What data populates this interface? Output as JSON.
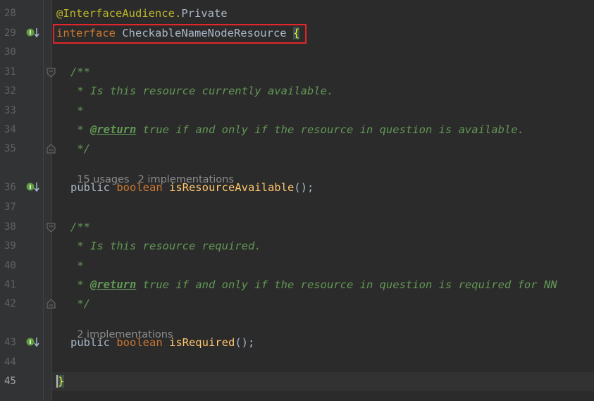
{
  "editor": {
    "lines": [
      {
        "num": "28",
        "text_ann": "@InterfaceAudience.",
        "text_ann2": "Private"
      },
      {
        "num": "29",
        "kw": "interface ",
        "name": "CheckableNameNodeResource ",
        "brace": "{"
      },
      {
        "num": "30"
      },
      {
        "num": "31",
        "doc": "/**"
      },
      {
        "num": "32",
        "doc": " * Is this resource currently available."
      },
      {
        "num": "33",
        "doc": " *"
      },
      {
        "num": "34",
        "doc_prefix": " * ",
        "doctag": "@return",
        "doc": " true if and only if the resource in question is available."
      },
      {
        "num": "35",
        "doc": " */"
      },
      {
        "num": "36",
        "public": "public ",
        "type": "boolean ",
        "method": "isResourceAvailable",
        "tail": "();"
      },
      {
        "num": "37"
      },
      {
        "num": "38",
        "doc": "/**"
      },
      {
        "num": "39",
        "doc": " * Is this resource required."
      },
      {
        "num": "40",
        "doc": " *"
      },
      {
        "num": "41",
        "doc_prefix": " * ",
        "doctag": "@return",
        "doc": " true if and only if the resource in question is required for NN"
      },
      {
        "num": "42",
        "doc": " */"
      },
      {
        "num": "43",
        "public": "public ",
        "type": "boolean ",
        "method": "isRequired",
        "tail": "();"
      },
      {
        "num": "44"
      },
      {
        "num": "45",
        "brace": "}"
      }
    ],
    "inlay1": {
      "usages": "15 usages",
      "impls": "2 implementations"
    },
    "inlay2": {
      "impls": "2 implementations"
    }
  },
  "colors": {
    "background": "#2b2b2b",
    "keyword": "#cc7832",
    "annotation": "#bbb529",
    "method": "#ffc66d",
    "doc_comment": "#629755",
    "highlight_box": "#e3262b"
  },
  "icons": {
    "implemented": "implemented-interface-icon",
    "fold": "fold-marker-icon"
  }
}
